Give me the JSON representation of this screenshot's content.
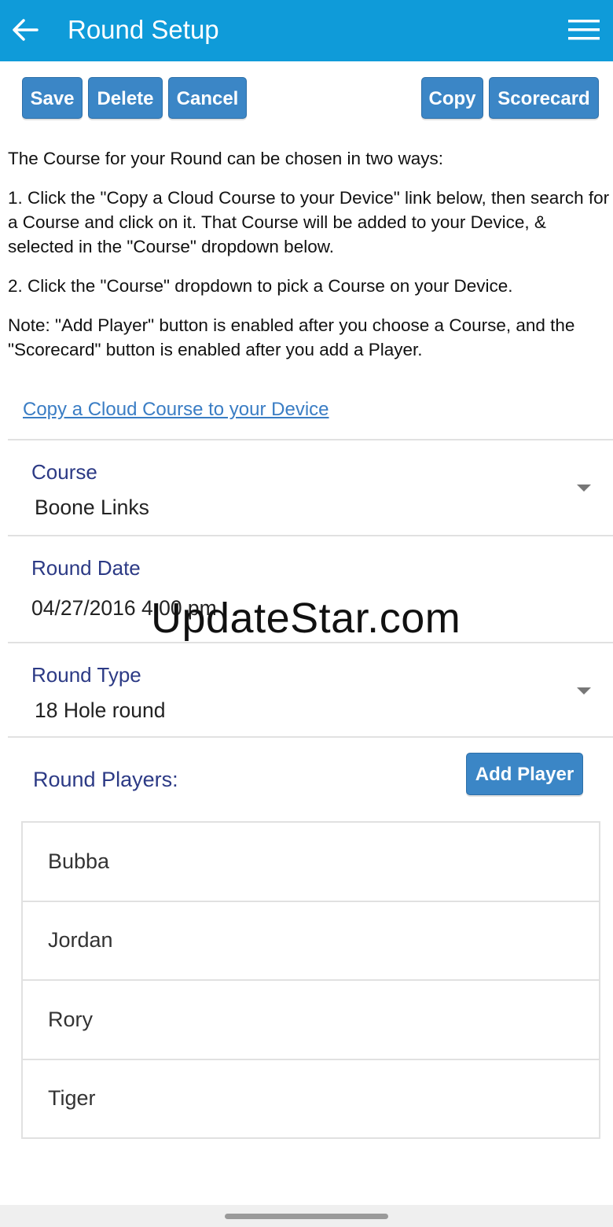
{
  "header": {
    "title": "Round Setup",
    "background_color": "#0f9bd9"
  },
  "toolbar": {
    "save_label": "Save",
    "delete_label": "Delete",
    "cancel_label": "Cancel",
    "copy_label": "Copy",
    "scorecard_label": "Scorecard",
    "button_color": "#3b86c6"
  },
  "instructions": {
    "intro": "The Course for your Round can be chosen in two ways:",
    "step1": "1. Click the \"Copy a Cloud Course to your Device\" link below, then search for a Course and click on it. That Course will be added to your Device, & selected in the \"Course\" dropdown below.",
    "step2": "2. Click the \"Course\" dropdown to pick a Course on your Device.",
    "note": "Note: \"Add Player\" button is enabled after you choose a Course, and the \"Scorecard\" button is enabled after you add a Player."
  },
  "cloud_link": "Copy a Cloud Course to your Device",
  "course": {
    "label": "Course",
    "value": "Boone Links"
  },
  "round_date": {
    "label": "Round Date",
    "value": "04/27/2016 4:00 pm"
  },
  "round_type": {
    "label": "Round Type",
    "value": "18 Hole round"
  },
  "players": {
    "label": "Round Players:",
    "add_button": "Add Player",
    "list": [
      "Bubba",
      "Jordan",
      "Rory",
      "Tiger"
    ]
  },
  "watermark": "UpdateStar.com"
}
